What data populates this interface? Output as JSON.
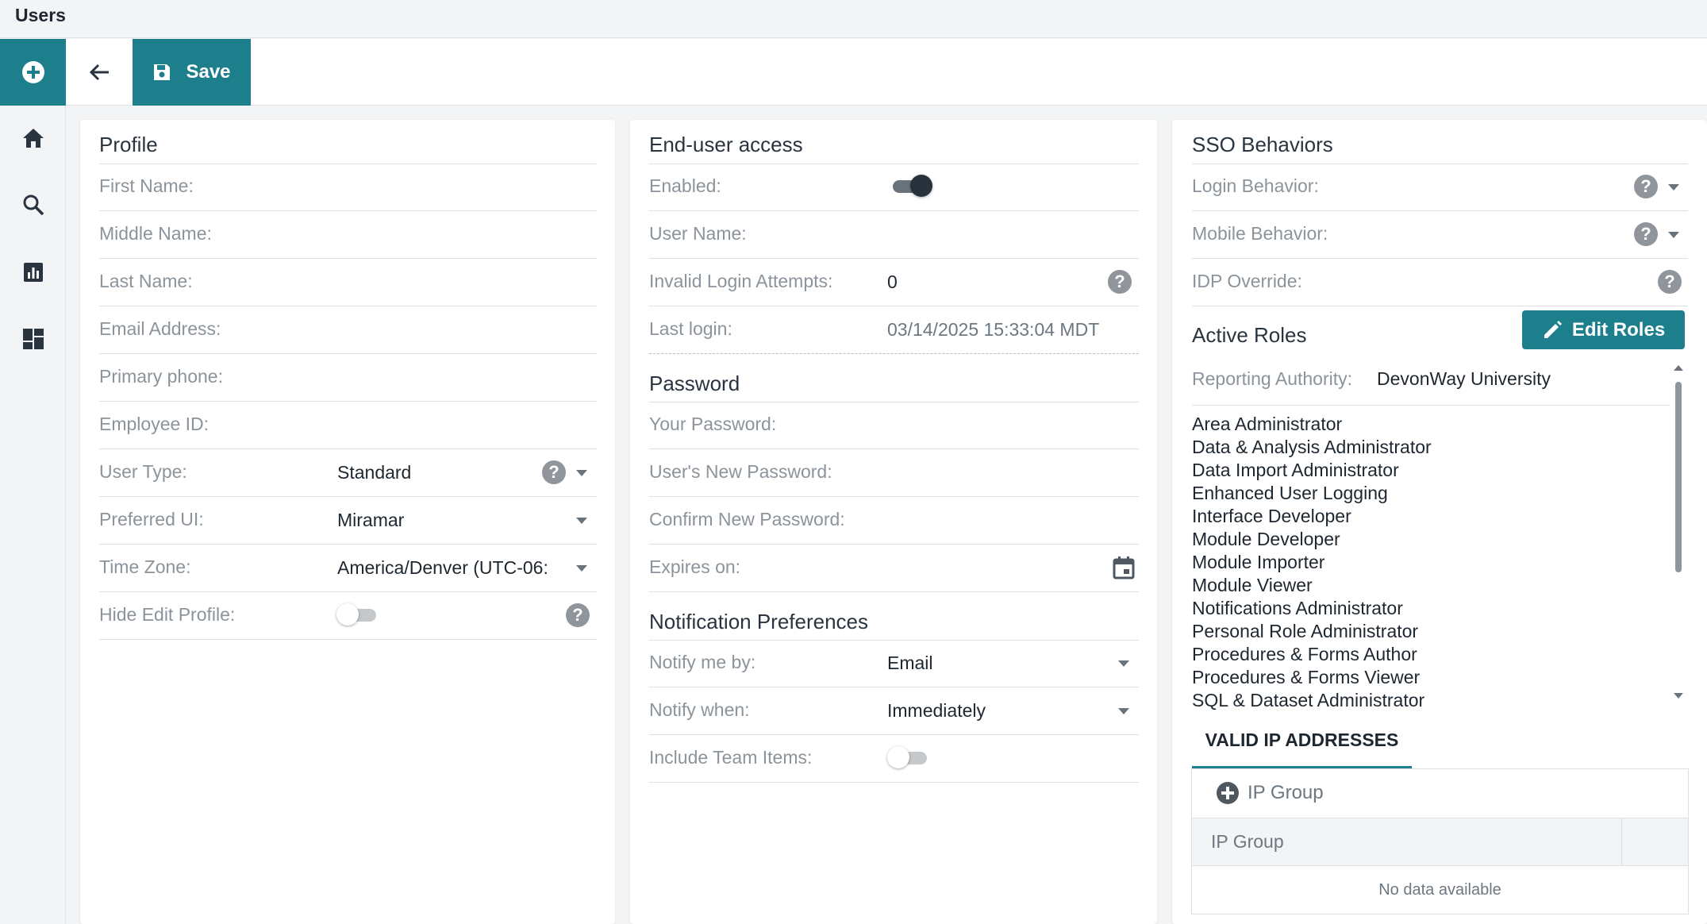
{
  "app": {
    "title": "Users"
  },
  "toolbar": {
    "save_label": "Save"
  },
  "profile": {
    "title": "Profile",
    "fields": [
      {
        "label": "First Name:",
        "value": ""
      },
      {
        "label": "Middle Name:",
        "value": ""
      },
      {
        "label": "Last Name:",
        "value": ""
      },
      {
        "label": "Email Address:",
        "value": ""
      },
      {
        "label": "Primary phone:",
        "value": ""
      },
      {
        "label": "Employee ID:",
        "value": ""
      },
      {
        "label": "User Type:",
        "value": "Standard"
      },
      {
        "label": "Preferred UI:",
        "value": "Miramar"
      },
      {
        "label": "Time Zone:",
        "value": "America/Denver (UTC-06:"
      },
      {
        "label": "Hide Edit Profile:",
        "value": "off"
      }
    ]
  },
  "access": {
    "title": "End-user access",
    "enabled_label": "Enabled:",
    "enabled": true,
    "username_label": "User Name:",
    "invalid_attempts_label": "Invalid Login Attempts:",
    "invalid_attempts": "0",
    "last_login_label": "Last login:",
    "last_login": "03/14/2025 15:33:04 MDT"
  },
  "password": {
    "title": "Password",
    "your_password_label": "Your Password:",
    "new_password_label": "User's New Password:",
    "confirm_label": "Confirm New Password:",
    "expires_label": "Expires on:"
  },
  "notifications": {
    "title": "Notification Preferences",
    "notify_by_label": "Notify me by:",
    "notify_by": "Email",
    "notify_when_label": "Notify when:",
    "notify_when": "Immediately",
    "include_team_label": "Include Team Items:",
    "include_team": false
  },
  "sso": {
    "title": "SSO Behaviors",
    "login_behavior_label": "Login Behavior:",
    "mobile_behavior_label": "Mobile Behavior:",
    "idp_override_label": "IDP Override:"
  },
  "roles": {
    "title": "Active Roles",
    "edit_label": "Edit Roles",
    "reporting_authority_label": "Reporting Authority:",
    "reporting_authority": "DevonWay University",
    "items": [
      "Area Administrator",
      "Data & Analysis Administrator",
      "Data Import Administrator",
      "Enhanced User Logging",
      "Interface Developer",
      "Module Developer",
      "Module Importer",
      "Module Viewer",
      "Notifications Administrator",
      "Personal Role Administrator",
      "Procedures & Forms Author",
      "Procedures & Forms Viewer",
      "SQL & Dataset Administrator"
    ]
  },
  "ip": {
    "tab_label": "VALID IP ADDRESSES",
    "add_label": "IP Group",
    "column": "IP Group",
    "empty": "No data available"
  },
  "colors": {
    "accent": "#1d7f8b",
    "label": "#8b939b",
    "text": "#1e2730"
  }
}
